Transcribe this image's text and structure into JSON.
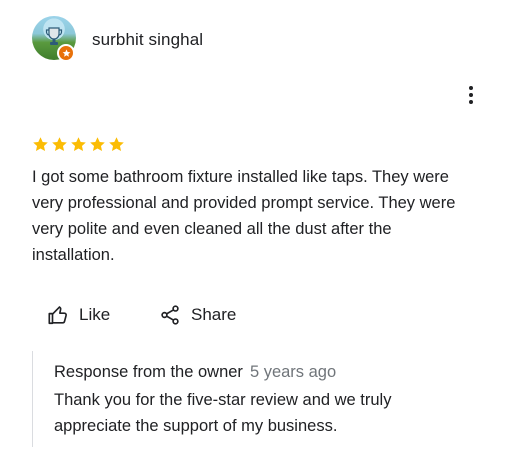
{
  "review": {
    "reviewer_name": "surbhit singhal",
    "rating": 5,
    "rating_max": 5,
    "star_color": "#fbbc04",
    "text": "I got some bathroom fixture installed like taps. They were very professional and provided prompt service. They were very polite and even cleaned all the dust after the installation."
  },
  "actions": {
    "like_label": "Like",
    "like_icon": "thumbs-up-icon",
    "share_label": "Share",
    "share_icon": "share-icon",
    "more_icon": "more-vertical-icon"
  },
  "owner_response": {
    "title": "Response from the owner",
    "time": "5 years ago",
    "text": "Thank you for the five-star review and we truly appreciate the support of my business."
  },
  "colors": {
    "text": "#202124",
    "secondary_text": "#70757a",
    "badge": "#e8710a",
    "divider": "#dadce0"
  }
}
